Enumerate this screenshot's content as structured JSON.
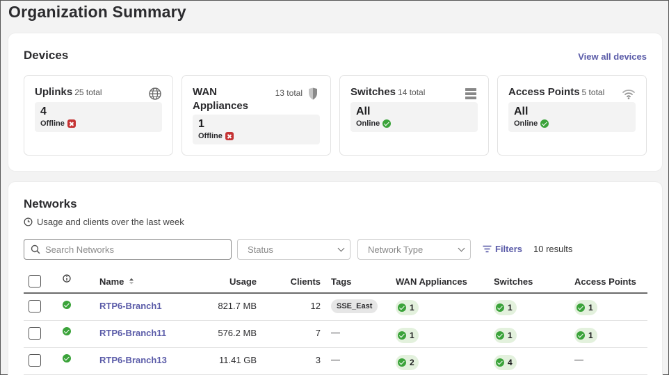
{
  "page": {
    "title": "Organization Summary"
  },
  "devices": {
    "title": "Devices",
    "view_all": "View all devices",
    "tiles": [
      {
        "name": "Uplinks",
        "total": "25 total",
        "value": "4",
        "status": "Offline",
        "status_kind": "bad",
        "icon": "globe-icon"
      },
      {
        "name": "WAN Appliances",
        "total": "13 total",
        "value": "1",
        "status": "Offline",
        "status_kind": "bad",
        "icon": "shield-icon"
      },
      {
        "name": "Switches",
        "total": "14 total",
        "value": "All",
        "status": "Online",
        "status_kind": "ok",
        "icon": "switch-stack-icon"
      },
      {
        "name": "Access Points",
        "total": "5 total",
        "value": "All",
        "status": "Online",
        "status_kind": "ok",
        "icon": "wifi-icon"
      }
    ]
  },
  "networks": {
    "title": "Networks",
    "subtitle": "Usage and clients over the last week",
    "search_placeholder": "Search Networks",
    "status_placeholder": "Status",
    "network_type_placeholder": "Network Type",
    "filters_label": "Filters",
    "results": "10 results",
    "columns": [
      "Name",
      "Usage",
      "Clients",
      "Tags",
      "WAN Appliances",
      "Switches",
      "Access Points"
    ],
    "rows": [
      {
        "name": "RTP6-Branch1",
        "usage": "821.7 MB",
        "clients": "12",
        "tag": "SSE_East",
        "wan": "1",
        "switches": "1",
        "aps": "1"
      },
      {
        "name": "RTP6-Branch11",
        "usage": "576.2 MB",
        "clients": "7",
        "tag": "—",
        "wan": "1",
        "switches": "1",
        "aps": "1"
      },
      {
        "name": "RTP6-Branch13",
        "usage": "11.41 GB",
        "clients": "3",
        "tag": "—",
        "wan": "2",
        "switches": "4",
        "aps": "—"
      }
    ]
  },
  "colors": {
    "accent": "#5a5ba8",
    "ok": "#3ba33a",
    "bad": "#c53334"
  }
}
